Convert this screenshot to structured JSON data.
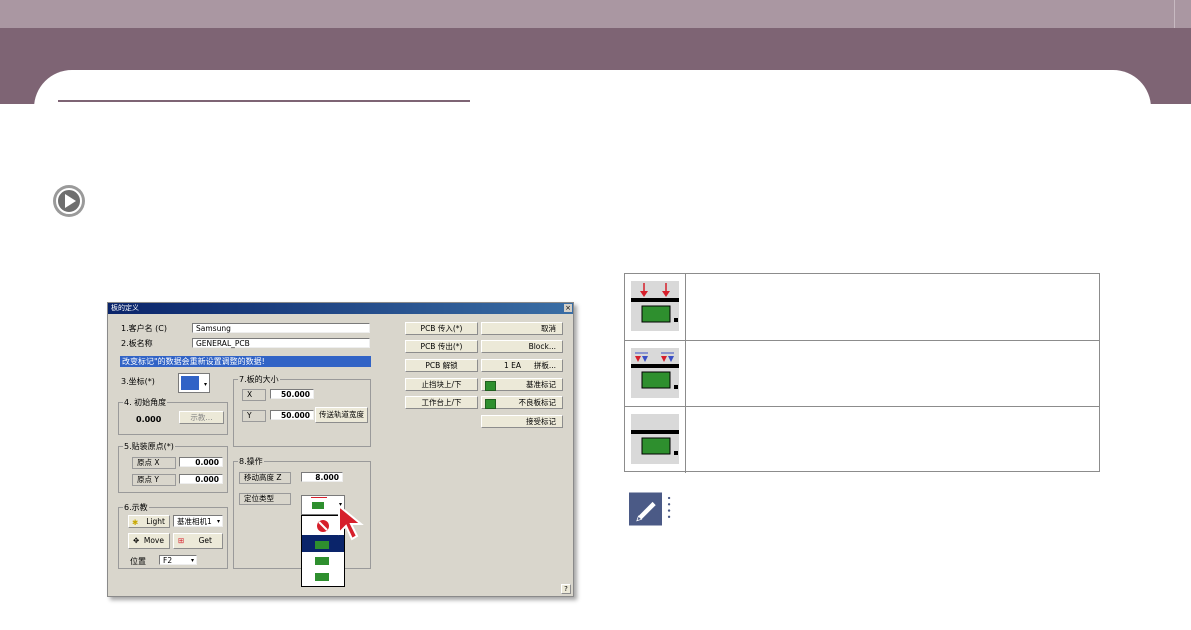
{
  "dialog": {
    "title": "板的定义",
    "close_glyph": "×",
    "customer_label": "1.客户名 (C)",
    "customer_value": "Samsung",
    "board_label": "2.板名称",
    "board_value": "GENERAL_PCB",
    "banner": "改变标记\"的数据会重新设置调整的数据!",
    "coord_label": "3.坐标(*)",
    "angle_group": "4. 初始角度",
    "angle_value": "0.000",
    "teach_btn": "示教...",
    "size_group": "7.板的大小",
    "size_x_label": "X",
    "size_x_value": "50.000",
    "size_y_label": "Y",
    "size_y_value": "50.000",
    "conveyor_btn": "传送轨道宽度",
    "origin_group": "5.贴装原点(*)",
    "origin_x_label": "原点 X",
    "origin_x_value": "0.000",
    "origin_y_label": "原点 Y",
    "origin_y_value": "0.000",
    "op_group": "8.操作",
    "move_z_label": "移动高度 Z",
    "move_z_value": "8.000",
    "locate_label": "定位类型",
    "teach_group": "6.示教",
    "light_btn": "Light",
    "camera_select": "基准相机1",
    "move_btn": "Move",
    "get_btn": "Get",
    "position_label": "位置",
    "position_value": "F2",
    "help_glyph": "?",
    "buttons_left": [
      "PCB 传入(*)",
      "PCB 传出(*)",
      "PCB 解锁",
      "止挡块上/下",
      "工作台上/下"
    ],
    "buttons_right": [
      "取消",
      "Block...",
      "基准标记",
      "不良板标记",
      "接受标记"
    ],
    "panel_count": "1 EA",
    "panel_btn": "拼板..."
  },
  "colors": {
    "header_top": "#aa97a2",
    "header_band": "#7e6474",
    "banner": "#3163c6",
    "accent_red": "#d61f2b"
  },
  "icons": [
    "play-icon",
    "note-pencil-icon",
    "red-arrow-cursor-icon"
  ]
}
